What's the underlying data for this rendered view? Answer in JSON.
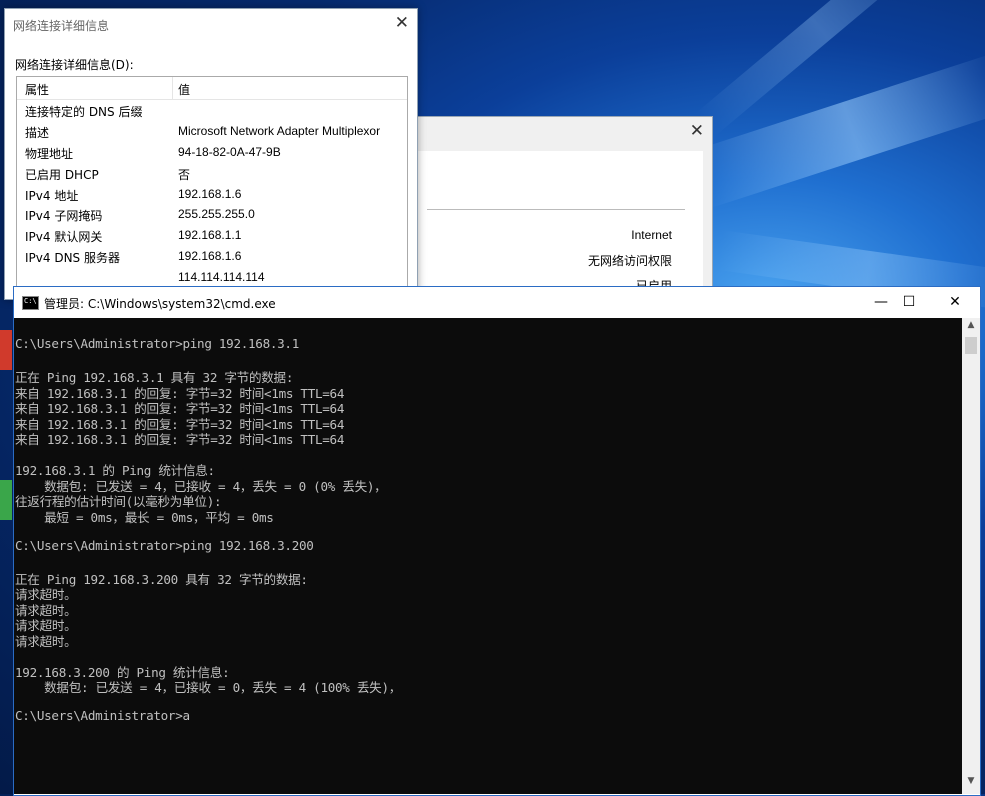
{
  "details_dialog": {
    "title": "网络连接详细信息",
    "close_glyph": "✕",
    "list_label": "网络连接详细信息(D):",
    "columns": [
      "属性",
      "值"
    ],
    "rows": [
      {
        "prop": "连接特定的 DNS 后缀",
        "value": ""
      },
      {
        "prop": "描述",
        "value": "Microsoft Network Adapter Multiplexor"
      },
      {
        "prop": "物理地址",
        "value": "94-18-82-0A-47-9B"
      },
      {
        "prop": "已启用 DHCP",
        "value": "否"
      },
      {
        "prop": "IPv4 地址",
        "value": "192.168.1.6"
      },
      {
        "prop": "IPv4 子网掩码",
        "value": "255.255.255.0"
      },
      {
        "prop": "IPv4 默认网关",
        "value": "192.168.1.1"
      },
      {
        "prop": "IPv4 DNS 服务器",
        "value": "192.168.1.6"
      },
      {
        "prop": "",
        "value": "114.114.114.114"
      }
    ]
  },
  "status_dialog": {
    "close_glyph": "✕",
    "rows": [
      "Internet",
      "无网络访问权限",
      "已启用"
    ]
  },
  "cmd_window": {
    "title": "管理员: C:\\Windows\\system32\\cmd.exe",
    "icon_text": "C:\\",
    "minimize_glyph": "—",
    "maximize_glyph": "☐",
    "close_glyph": "✕",
    "lines": [
      "C:\\Users\\Administrator>ping 192.168.3.1",
      "",
      "正在 Ping 192.168.3.1 具有 32 字节的数据:",
      "来自 192.168.3.1 的回复: 字节=32 时间<1ms TTL=64",
      "来自 192.168.3.1 的回复: 字节=32 时间<1ms TTL=64",
      "来自 192.168.3.1 的回复: 字节=32 时间<1ms TTL=64",
      "来自 192.168.3.1 的回复: 字节=32 时间<1ms TTL=64",
      "",
      "192.168.3.1 的 Ping 统计信息:",
      "    数据包: 已发送 = 4，已接收 = 4，丢失 = 0 (0% 丢失)，",
      "往返行程的估计时间(以毫秒为单位):",
      "    最短 = 0ms，最长 = 0ms，平均 = 0ms",
      "",
      "C:\\Users\\Administrator>ping 192.168.3.200",
      "",
      "正在 Ping 192.168.3.200 具有 32 字节的数据:",
      "请求超时。",
      "请求超时。",
      "请求超时。",
      "请求超时。",
      "",
      "192.168.3.200 的 Ping 统计信息:",
      "    数据包: 已发送 = 4，已接收 = 0，丢失 = 4 (100% 丢失)，",
      "",
      "C:\\Users\\Administrator>a"
    ]
  },
  "colors": {
    "console_bg": "#0c0c0c",
    "console_fg": "#c0c0c0",
    "desktop_blue": "#0b3f9a"
  }
}
